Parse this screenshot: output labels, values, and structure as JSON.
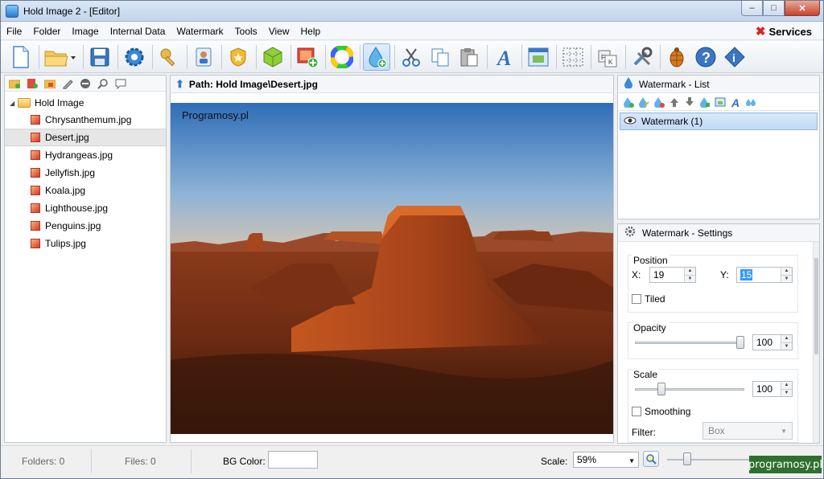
{
  "window": {
    "title": "Hold Image 2 - [Editor]",
    "minimize": "–",
    "maximize": "□",
    "close": "✕"
  },
  "menu": {
    "items": [
      "File",
      "Folder",
      "Image",
      "Internal Data",
      "Watermark",
      "Tools",
      "View",
      "Help"
    ],
    "services": "Services"
  },
  "toolbar": {
    "icons": [
      "new-document-icon",
      "open-folder-icon",
      "save-icon",
      "settings-gear-icon",
      "keys-icon",
      "contact-card-icon",
      "badge-icon",
      "cube-package-icon",
      "add-image-icon",
      "color-wheel-icon",
      "add-watermark-icon",
      "cut-icon",
      "copy-icon",
      "paste-icon",
      "text-a-icon",
      "image-frame-icon",
      "grid-icon",
      "keyboard-icon",
      "tools-icon",
      "bug-icon",
      "help-icon",
      "info-icon"
    ]
  },
  "tree": {
    "root": "Hold Image",
    "files": [
      "Chrysanthemum.jpg",
      "Desert.jpg",
      "Hydrangeas.jpg",
      "Jellyfish.jpg",
      "Koala.jpg",
      "Lighthouse.jpg",
      "Penguins.jpg",
      "Tulips.jpg"
    ],
    "selected_index": 1
  },
  "path": {
    "label": "Path: Hold Image\\Desert.jpg"
  },
  "canvas": {
    "watermark_text": "Programosy.pl"
  },
  "watermark_list": {
    "title": "Watermark - List",
    "items": [
      "Watermark (1)"
    ]
  },
  "settings": {
    "title": "Watermark - Settings",
    "position": {
      "label": "Position",
      "x_label": "X:",
      "x_value": "19",
      "y_label": "Y:",
      "y_value": "15",
      "tiled_label": "Tiled",
      "tiled": false
    },
    "opacity": {
      "label": "Opacity",
      "value": "100",
      "level": 1.0
    },
    "scale": {
      "label": "Scale",
      "value": "100",
      "smoothing_label": "Smoothing",
      "smoothing": false
    },
    "filter": {
      "label": "Filter:",
      "value": "Box"
    }
  },
  "status": {
    "folders": "Folders: 0",
    "files": "Files: 0",
    "bg_color_label": "BG Color:",
    "scale_label": "Scale:",
    "scale_value": "59%",
    "brand": "programosy.pl"
  }
}
